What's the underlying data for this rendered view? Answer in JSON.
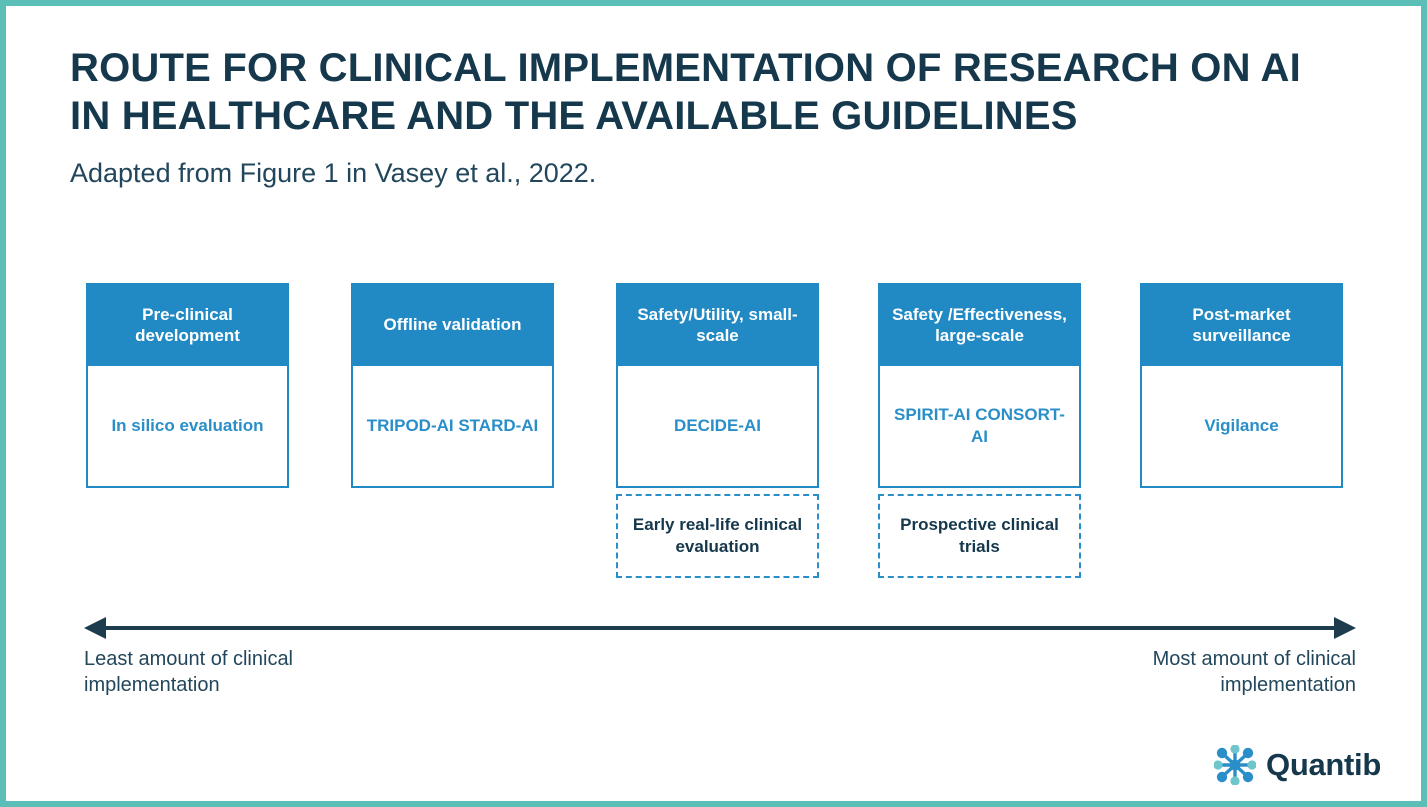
{
  "title": "ROUTE FOR CLINICAL IMPLEMENTATION OF RESEARCH ON AI IN HEALTHCARE AND THE AVAILABLE GUIDELINES",
  "subtitle": "Adapted from Figure 1 in Vasey et al., 2022.",
  "colors": {
    "frame": "#5bbfb8",
    "header_blue": "#2189c4",
    "text_blue": "#2a8fc8",
    "navy": "#16384c"
  },
  "stages": [
    {
      "header": "Pre-clinical development",
      "body": "In silico evaluation",
      "extra": ""
    },
    {
      "header": "Offline validation",
      "body": "TRIPOD-AI STARD-AI",
      "extra": ""
    },
    {
      "header": "Safety/Utility, small-scale",
      "body": "DECIDE-AI",
      "extra": "Early real-life clinical evaluation"
    },
    {
      "header": "Safety /Effectiveness, large-scale",
      "body": "SPIRIT-AI CONSORT-AI",
      "extra": "Prospective clinical trials"
    },
    {
      "header": "Post-market surveillance",
      "body": "Vigilance",
      "extra": ""
    }
  ],
  "axis": {
    "left_label": "Least amount of clinical implementation",
    "right_label": "Most amount of clinical implementation"
  },
  "logo": {
    "wordmark": "Quantib",
    "mark_name": "quantib-network-logo"
  }
}
